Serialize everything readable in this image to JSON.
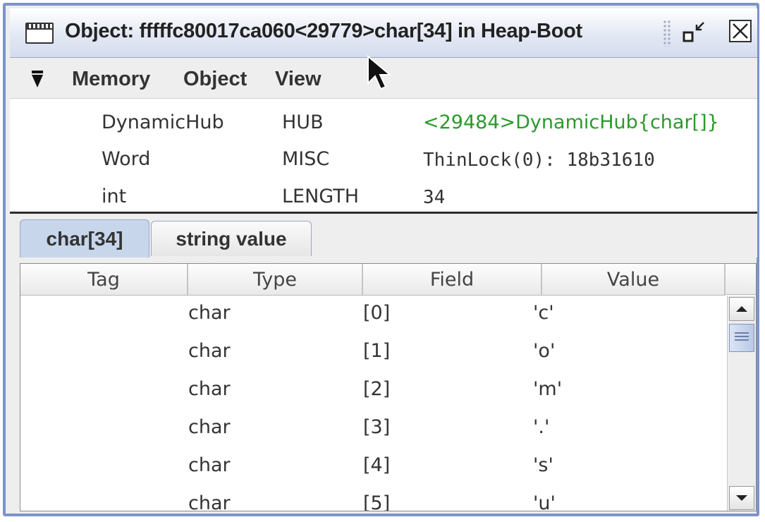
{
  "window": {
    "title": "Object: fffffc80017ca060<29779>char[34] in Heap-Boot"
  },
  "icons": {
    "window": "window-icon",
    "restore": "restore-icon",
    "close": "close-icon",
    "menu": "triangle-down-icon",
    "cursor": "mouse-cursor-icon",
    "scroll_up": "arrow-up-icon",
    "scroll_down": "arrow-down-icon"
  },
  "menubar": {
    "items": [
      "Memory",
      "Object",
      "View"
    ]
  },
  "fields": [
    {
      "type": "DynamicHub",
      "name": "HUB",
      "value": "<29484>DynamicHub{char[]}"
    },
    {
      "type": "Word",
      "name": "MISC",
      "value": "ThinLock(0): 18b31610"
    },
    {
      "type": "int",
      "name": "LENGTH",
      "value": "34"
    }
  ],
  "tabs": [
    {
      "label": "char[34]"
    },
    {
      "label": "string value"
    }
  ],
  "table": {
    "columns": [
      "Tag",
      "Type",
      "Field",
      "Value"
    ],
    "rows": [
      {
        "tag": "",
        "type": "char",
        "field": "[0]",
        "value": "'c'"
      },
      {
        "tag": "",
        "type": "char",
        "field": "[1]",
        "value": "'o'"
      },
      {
        "tag": "",
        "type": "char",
        "field": "[2]",
        "value": "'m'"
      },
      {
        "tag": "",
        "type": "char",
        "field": "[3]",
        "value": "'.'"
      },
      {
        "tag": "",
        "type": "char",
        "field": "[4]",
        "value": "'s'"
      },
      {
        "tag": "",
        "type": "char",
        "field": "[5]",
        "value": "'u'"
      }
    ]
  },
  "colors": {
    "link_green": "#2a9a2a",
    "frame_blue": "#7d94c8",
    "active_tab": "#c8d6ec"
  }
}
